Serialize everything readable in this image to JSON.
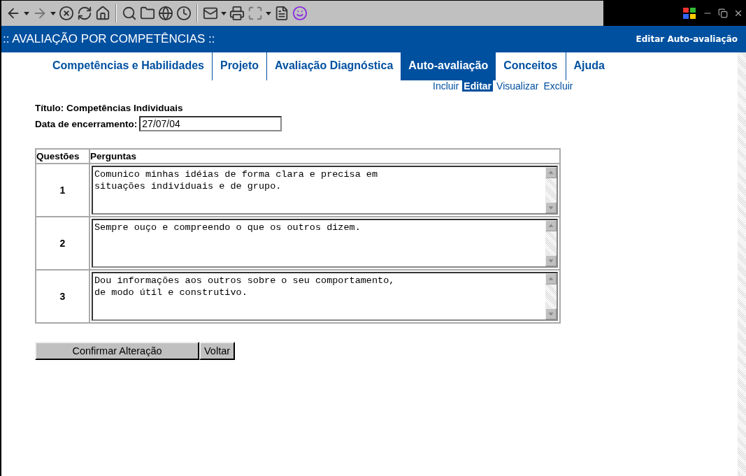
{
  "app_title": ":: AVALIAÇÃO POR COMPETÊNCIAS ::",
  "header_action": "Editar Auto-avaliação",
  "tabs": [
    {
      "label": "Competências e Habilidades",
      "selected": false
    },
    {
      "label": "Projeto",
      "selected": false
    },
    {
      "label": "Avaliação Diagnóstica",
      "selected": false
    },
    {
      "label": "Auto-avaliação",
      "selected": true
    },
    {
      "label": "Conceitos",
      "selected": false
    },
    {
      "label": "Ajuda",
      "selected": false
    }
  ],
  "subtabs": [
    {
      "label": "Incluir",
      "selected": false
    },
    {
      "label": "Editar",
      "selected": true
    },
    {
      "label": "Visualizar",
      "selected": false
    },
    {
      "label": "Excluir",
      "selected": false
    }
  ],
  "title_line": "Título: Competências Individuais",
  "date_field": {
    "label": "Data de encerramento:",
    "value": "27/07/04"
  },
  "table": {
    "columns": [
      "Questões",
      "Perguntas"
    ],
    "rows": [
      {
        "number": "1",
        "question": "Comunico minhas idéias de forma clara e precisa em situações individuais e de grupo."
      },
      {
        "number": "2",
        "question": "Sempre ouço e compreendo o que os outros dizem."
      },
      {
        "number": "3",
        "question": "Dou informações aos outros sobre o seu comportamento, de modo útil e construtivo."
      }
    ]
  },
  "buttons": [
    "Confirmar Alteração",
    "Voltar"
  ]
}
